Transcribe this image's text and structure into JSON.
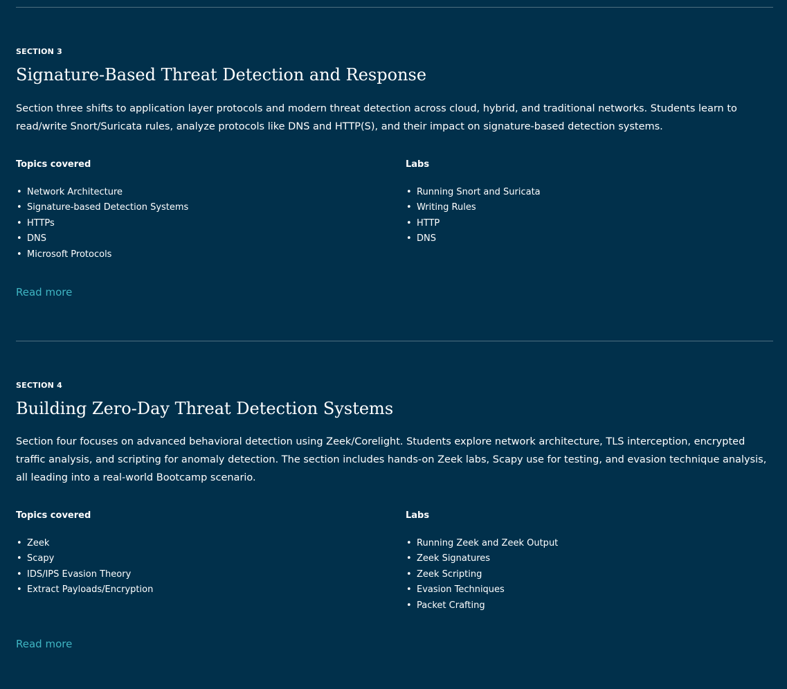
{
  "theme": {
    "background": "#01304b",
    "text": "#ffffff",
    "link": "#3fb5c3",
    "divider": "#4f6f80"
  },
  "sections": [
    {
      "label": "SECTION 3",
      "title": "Signature-Based Threat Detection and Response",
      "description": "Section three shifts to application layer protocols and modern threat detection across cloud, hybrid, and traditional networks. Students learn to read/write Snort/Suricata rules, analyze protocols like DNS and HTTP(S), and their impact on signature-based detection systems.",
      "topics": {
        "heading": "Topics covered",
        "items": [
          "Network Architecture",
          "Signature-based Detection Systems",
          "HTTPs",
          "DNS",
          "Microsoft Protocols"
        ]
      },
      "labs": {
        "heading": "Labs",
        "items": [
          "Running Snort and Suricata",
          "Writing Rules",
          "HTTP",
          "DNS"
        ]
      },
      "read_more": "Read more"
    },
    {
      "label": "SECTION 4",
      "title": "Building Zero-Day Threat Detection Systems",
      "description": "Section four focuses on advanced behavioral detection using Zeek/Corelight. Students explore network architecture, TLS interception, encrypted traffic analysis, and scripting for anomaly detection. The section includes hands-on Zeek labs, Scapy use for testing, and evasion technique analysis, all leading into a real-world Bootcamp scenario.",
      "topics": {
        "heading": "Topics covered",
        "items": [
          "Zeek",
          "Scapy",
          "IDS/IPS Evasion Theory",
          "Extract Payloads/Encryption"
        ]
      },
      "labs": {
        "heading": "Labs",
        "items": [
          "Running Zeek and Zeek Output",
          "Zeek Signatures",
          "Zeek Scripting",
          "Evasion Techniques",
          "Packet Crafting"
        ]
      },
      "read_more": "Read more"
    }
  ]
}
